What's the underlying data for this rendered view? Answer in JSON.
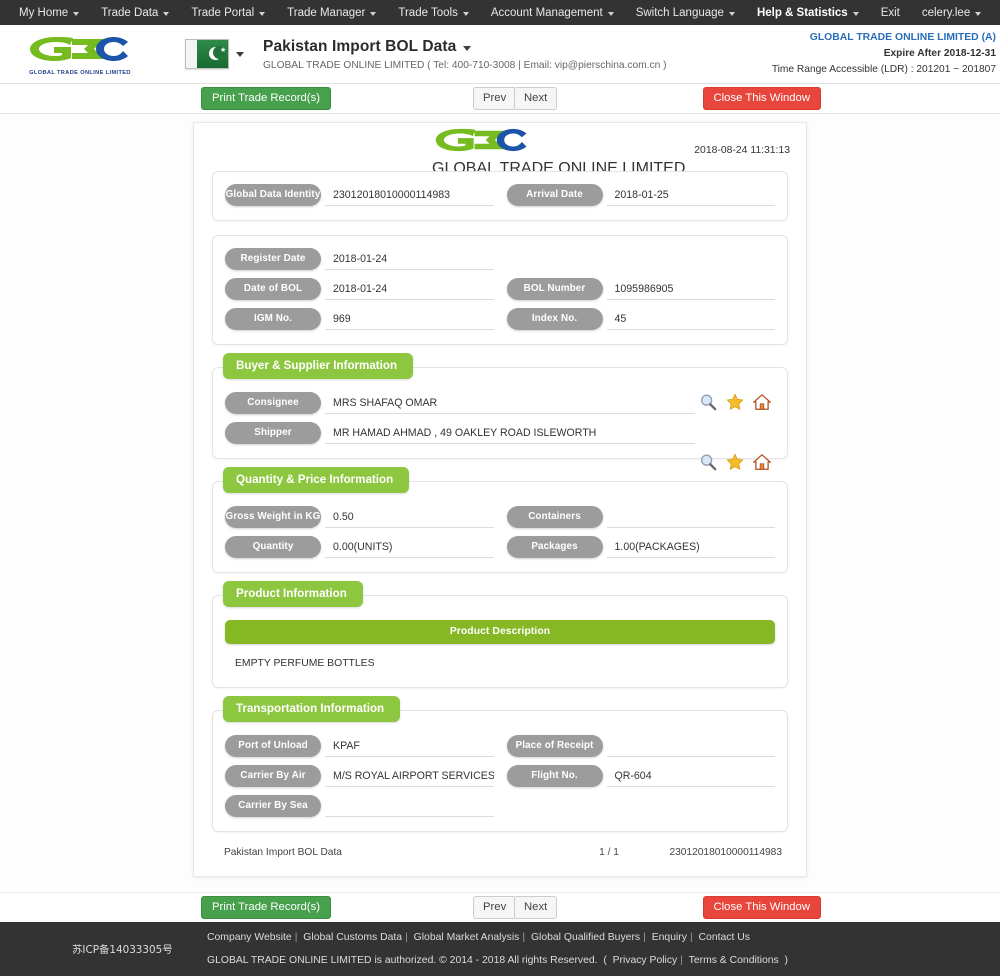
{
  "topnav": {
    "items": [
      {
        "label": "My Home",
        "caret": true,
        "bold": false
      },
      {
        "label": "Trade Data",
        "caret": true,
        "bold": false
      },
      {
        "label": "Trade Portal",
        "caret": true,
        "bold": false
      },
      {
        "label": "Trade Manager",
        "caret": true,
        "bold": false
      },
      {
        "label": "Trade Tools",
        "caret": true,
        "bold": false
      },
      {
        "label": "Account Management",
        "caret": true,
        "bold": false
      },
      {
        "label": "Switch Language",
        "caret": true,
        "bold": false
      },
      {
        "label": "Help & Statistics",
        "caret": true,
        "bold": true
      },
      {
        "label": "Exit",
        "caret": false,
        "bold": false
      }
    ],
    "user": "celery.lee"
  },
  "header": {
    "logo_tagline": "GLOBAL TRADE  ONLINE LIMITED",
    "flag_country": "Pakistan",
    "title": "Pakistan Import BOL Data",
    "subtitle": "GLOBAL TRADE ONLINE LIMITED ( Tel: 400-710-3008 | Email: vip@pierschina.com.cn )",
    "account": "GLOBAL TRADE ONLINE LIMITED (A)",
    "expire": "Expire After 2018-12-31",
    "time_range": "Time Range Accessible (LDR) : 201201 ~ 201807"
  },
  "toolbar": {
    "print_label": "Print Trade Record(s)",
    "prev_label": "Prev",
    "next_label": "Next",
    "close_label": "Close This Window"
  },
  "document": {
    "logo_tagline": "GLOBAL TRADE  ONLINE LIMITED",
    "timestamp": "2018-08-24 11:31:13",
    "identity_section": {
      "fields": [
        {
          "label": "Global Data Identity",
          "value": "23012018010000114983"
        },
        {
          "label": "Arrival Date",
          "value": "2018-01-25"
        }
      ]
    },
    "bol_section": {
      "fields": [
        {
          "label": "Register Date",
          "value": "2018-01-24"
        },
        {
          "label": "Date of BOL",
          "value": "2018-01-24"
        },
        {
          "label": "BOL Number",
          "value": "1095986905"
        },
        {
          "label": "IGM No.",
          "value": "969"
        },
        {
          "label": "Index No.",
          "value": "45"
        }
      ]
    },
    "buyer_supplier": {
      "title": "Buyer & Supplier Information",
      "rows": [
        {
          "label": "Consignee",
          "value": "MRS SHAFAQ OMAR"
        },
        {
          "label": "Shipper",
          "value": "MR HAMAD AHMAD , 49 OAKLEY ROAD ISLEWORTH"
        }
      ],
      "icons": [
        "search-icon",
        "star-icon",
        "home-icon"
      ]
    },
    "quantity_price": {
      "title": "Quantity & Price Information",
      "fields": [
        {
          "label": "Gross Weight in KG",
          "value": "0.50"
        },
        {
          "label": "Containers",
          "value": ""
        },
        {
          "label": "Quantity",
          "value": "0.00(UNITS)"
        },
        {
          "label": "Packages",
          "value": "1.00(PACKAGES)"
        }
      ]
    },
    "product": {
      "title": "Product Information",
      "desc_label": "Product Description",
      "desc_value": "EMPTY PERFUME BOTTLES"
    },
    "transportation": {
      "title": "Transportation Information",
      "fields": [
        {
          "label": "Port of Unload",
          "value": "KPAF"
        },
        {
          "label": "Place of Receipt",
          "value": ""
        },
        {
          "label": "Carrier By Air",
          "value": "M/S ROYAL AIRPORT SERVICES (PV"
        },
        {
          "label": "Flight No.",
          "value": "QR-604"
        },
        {
          "label": "Carrier By Sea",
          "value": ""
        }
      ]
    },
    "footer": {
      "name": "Pakistan Import BOL Data",
      "page": "1 / 1",
      "identity": "23012018010000114983"
    }
  },
  "footer": {
    "icp": "苏ICP备14033305号",
    "links": [
      "Company Website",
      "Global Customs Data",
      "Global Market Analysis",
      "Global Qualified Buyers",
      "Enquiry",
      "Contact Us"
    ],
    "copyright": "GLOBAL TRADE ONLINE LIMITED is authorized. © 2014 - 2018 All rights Reserved.",
    "privacy": "Privacy Policy",
    "terms": "Terms & Conditions"
  },
  "colors": {
    "nav_bg": "#333333",
    "accent_green": "#8dc63f",
    "olive_green": "#86b826",
    "pill_gray": "#9c9c9c",
    "print_green": "#47a04c",
    "close_red": "#e8453c",
    "link_blue": "#2a6ebb"
  }
}
